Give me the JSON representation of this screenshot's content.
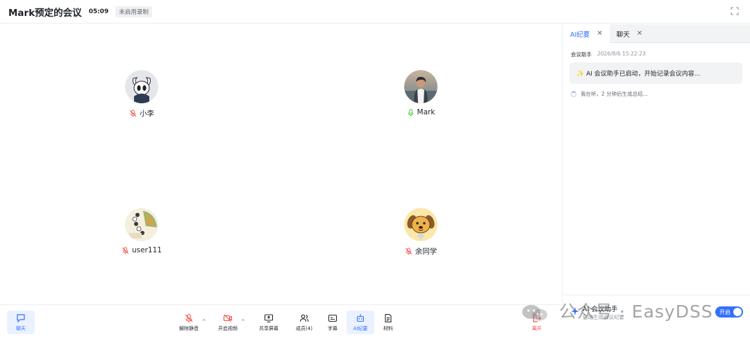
{
  "header": {
    "title": "Mark预定的会议",
    "timer": "05:09",
    "record_status": "未启用录制"
  },
  "participants": [
    {
      "name": "小李",
      "mic": "muted",
      "avatar": "hollow-knight-avatar"
    },
    {
      "name": "Mark",
      "mic": "on",
      "avatar": "person-photo-avatar"
    },
    {
      "name": "user111",
      "mic": "muted",
      "avatar": "illustration-avatar"
    },
    {
      "name": "余同学",
      "mic": "muted",
      "avatar": "dog-avatar"
    }
  ],
  "panel": {
    "tabs": [
      {
        "label": "AI纪要",
        "active": true
      },
      {
        "label": "聊天",
        "active": false
      }
    ],
    "message": {
      "sender": "会议助手",
      "time": "2026/8/6 15:22:23",
      "text": "AI 会议助手已启动，开始记录会议内容..."
    },
    "status": "我在听，2 分钟后生成总结...",
    "assistant": {
      "title": "AI 会议助手",
      "subtitle": "启动生成会议纪要",
      "toggle_label": "开启"
    }
  },
  "toolbar": {
    "chat": "聊天",
    "unmute": "解除静音",
    "start_video": "开启视频",
    "share_screen": "共享屏幕",
    "members": "成员(4)",
    "captions": "字幕",
    "ai_summary": "AI纪要",
    "materials": "材料",
    "leave": "离开"
  },
  "watermark": "公众号 · EasyDSS",
  "colors": {
    "accent": "#3370ff",
    "muted_mic": "#f54a45",
    "active_mic": "#34c724",
    "leave": "#f54a45"
  }
}
